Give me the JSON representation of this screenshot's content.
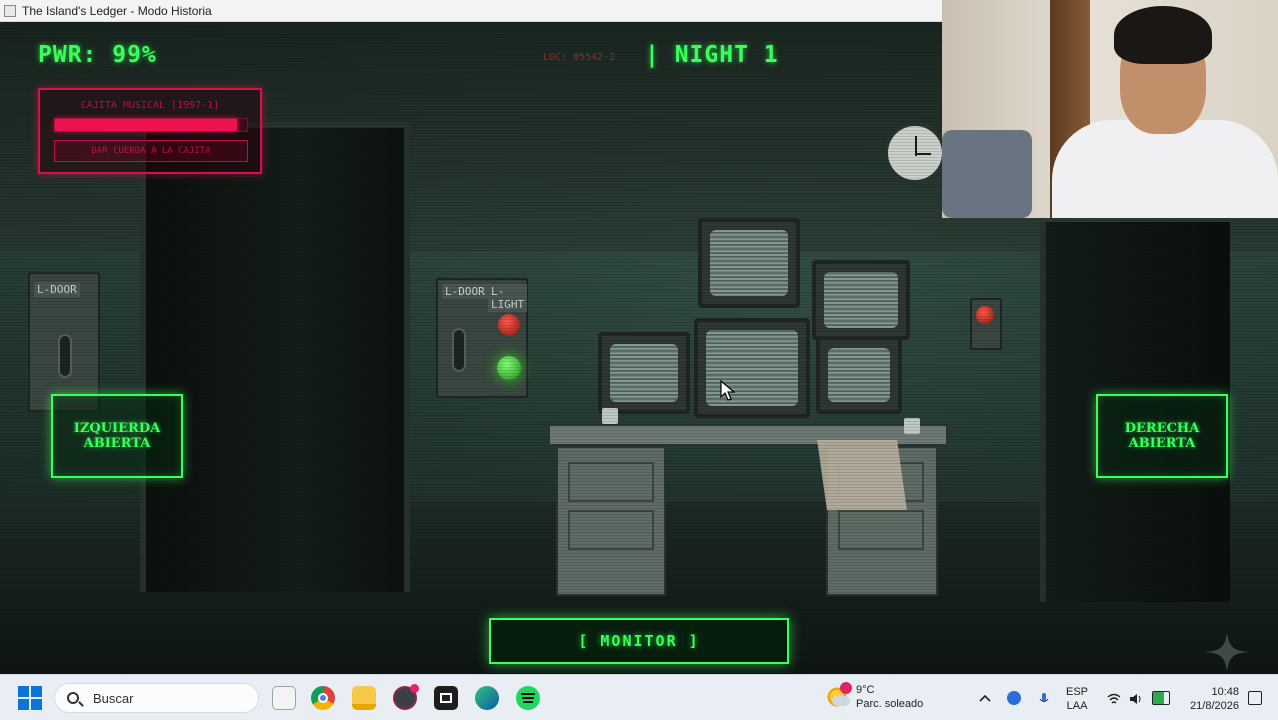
{
  "window": {
    "title": "The Island's Ledger - Modo Historia"
  },
  "hud": {
    "power": "PWR: 99%",
    "location": "LOC: #5542-2",
    "night": "| NIGHT 1"
  },
  "music_box": {
    "title": "CAJITA MUSICAL [1997-1]",
    "level": 0.95,
    "wind_button": "DAR CUERDA A LA CAJITA"
  },
  "scene": {
    "left_door_panel": "L-DOOR",
    "left_panel_door": "L-DOOR",
    "left_panel_light": "L-LIGHT"
  },
  "controls": {
    "left_door": "IZQUIERDA\nABIERTA",
    "right_door": "DERECHA\nABIERTA",
    "monitor": "[ MONITOR ]"
  },
  "taskbar": {
    "search_placeholder": "Buscar",
    "weather_temp": "9°C",
    "weather_desc": "Parc. soleado",
    "lang_top": "ESP",
    "lang_bottom": "LAA",
    "time": "10:48",
    "date": "21/8/2026"
  },
  "colors": {
    "hud_green": "#39ff5a",
    "music_red": "#d8104a",
    "taskbar_bg": "#e9eef5"
  }
}
